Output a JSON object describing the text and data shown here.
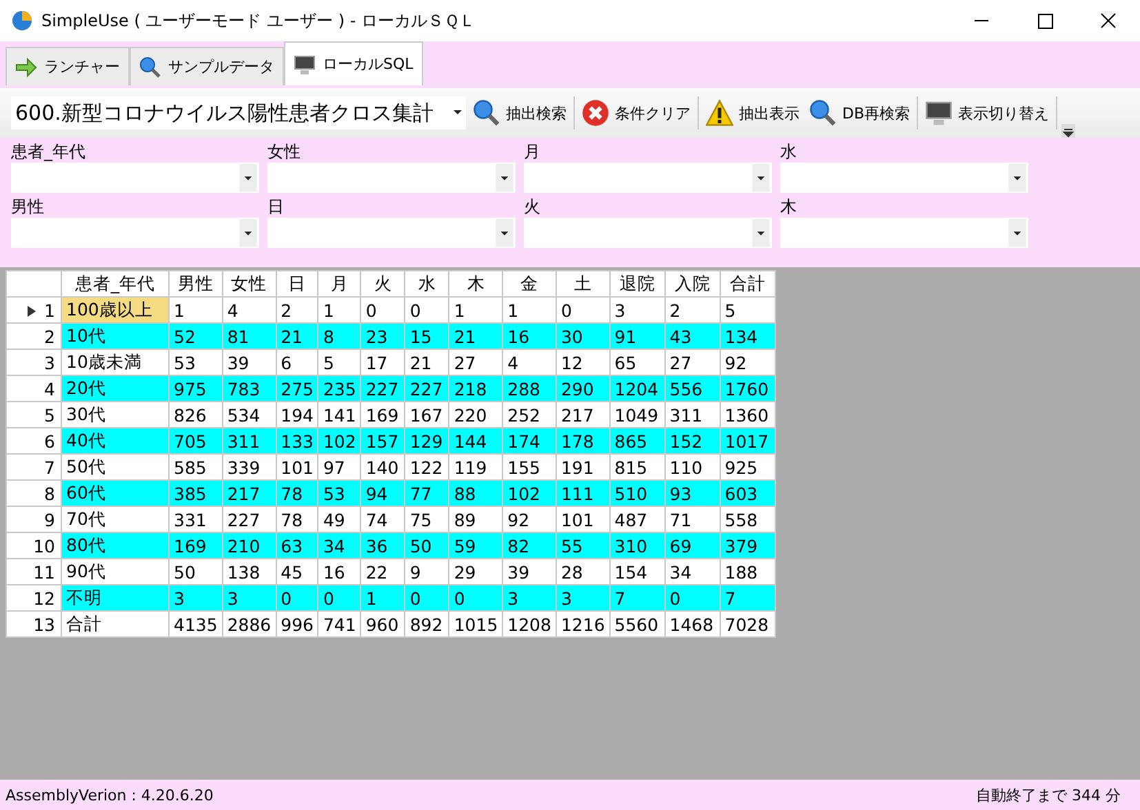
{
  "window": {
    "title": "SimpleUse ( ユーザーモード ユーザー ) - ローカルＳＱＬ"
  },
  "tabs": [
    {
      "label": "ランチャー",
      "selected": false
    },
    {
      "label": "サンプルデータ",
      "selected": false
    },
    {
      "label": "ローカルSQL",
      "selected": true
    }
  ],
  "toolbar": {
    "query": "600.新型コロナウイルス陽性患者クロス集計",
    "buttons": [
      {
        "label": "抽出検索"
      },
      {
        "label": "条件クリア"
      },
      {
        "label": "抽出表示"
      },
      {
        "label": "DB再検索"
      },
      {
        "label": "表示切り替え"
      }
    ]
  },
  "filters": [
    {
      "label": "患者_年代"
    },
    {
      "label": "女性"
    },
    {
      "label": "月"
    },
    {
      "label": "水"
    },
    {
      "label": "男性"
    },
    {
      "label": "日"
    },
    {
      "label": "火"
    },
    {
      "label": "木"
    }
  ],
  "table": {
    "columns": [
      "患者_年代",
      "男性",
      "女性",
      "日",
      "月",
      "火",
      "水",
      "木",
      "金",
      "土",
      "退院",
      "入院",
      "合計"
    ],
    "rows": [
      {
        "number": "1",
        "selected": true,
        "highlighted": false,
        "cells": [
          "100歳以上",
          "1",
          "4",
          "2",
          "1",
          "0",
          "0",
          "1",
          "1",
          "0",
          "3",
          "2",
          "5"
        ]
      },
      {
        "number": "2",
        "selected": false,
        "highlighted": true,
        "cells": [
          "10代",
          "52",
          "81",
          "21",
          "8",
          "23",
          "15",
          "21",
          "16",
          "30",
          "91",
          "43",
          "134"
        ]
      },
      {
        "number": "3",
        "selected": false,
        "highlighted": false,
        "cells": [
          "10歳未満",
          "53",
          "39",
          "6",
          "5",
          "17",
          "21",
          "27",
          "4",
          "12",
          "65",
          "27",
          "92"
        ]
      },
      {
        "number": "4",
        "selected": false,
        "highlighted": true,
        "cells": [
          "20代",
          "975",
          "783",
          "275",
          "235",
          "227",
          "227",
          "218",
          "288",
          "290",
          "1204",
          "556",
          "1760"
        ]
      },
      {
        "number": "5",
        "selected": false,
        "highlighted": false,
        "cells": [
          "30代",
          "826",
          "534",
          "194",
          "141",
          "169",
          "167",
          "220",
          "252",
          "217",
          "1049",
          "311",
          "1360"
        ]
      },
      {
        "number": "6",
        "selected": false,
        "highlighted": true,
        "cells": [
          "40代",
          "705",
          "311",
          "133",
          "102",
          "157",
          "129",
          "144",
          "174",
          "178",
          "865",
          "152",
          "1017"
        ]
      },
      {
        "number": "7",
        "selected": false,
        "highlighted": false,
        "cells": [
          "50代",
          "585",
          "339",
          "101",
          "97",
          "140",
          "122",
          "119",
          "155",
          "191",
          "815",
          "110",
          "925"
        ]
      },
      {
        "number": "8",
        "selected": false,
        "highlighted": true,
        "cells": [
          "60代",
          "385",
          "217",
          "78",
          "53",
          "94",
          "77",
          "88",
          "102",
          "111",
          "510",
          "93",
          "603"
        ]
      },
      {
        "number": "9",
        "selected": false,
        "highlighted": false,
        "cells": [
          "70代",
          "331",
          "227",
          "78",
          "49",
          "74",
          "75",
          "89",
          "92",
          "101",
          "487",
          "71",
          "558"
        ]
      },
      {
        "number": "10",
        "selected": false,
        "highlighted": true,
        "cells": [
          "80代",
          "169",
          "210",
          "63",
          "34",
          "36",
          "50",
          "59",
          "82",
          "55",
          "310",
          "69",
          "379"
        ]
      },
      {
        "number": "11",
        "selected": false,
        "highlighted": false,
        "cells": [
          "90代",
          "50",
          "138",
          "45",
          "16",
          "22",
          "9",
          "29",
          "39",
          "28",
          "154",
          "34",
          "188"
        ]
      },
      {
        "number": "12",
        "selected": false,
        "highlighted": true,
        "cells": [
          "不明",
          "3",
          "3",
          "0",
          "0",
          "1",
          "0",
          "0",
          "3",
          "3",
          "7",
          "0",
          "7"
        ]
      },
      {
        "number": "13",
        "selected": false,
        "highlighted": false,
        "cells": [
          "合計",
          "4135",
          "2886",
          "996",
          "741",
          "960",
          "892",
          "1015",
          "1208",
          "1216",
          "5560",
          "1468",
          "7028"
        ]
      }
    ]
  },
  "status_bar": {
    "left": "AssemblyVerion : 4.20.6.20",
    "right": "自動終了まで 344 分"
  }
}
